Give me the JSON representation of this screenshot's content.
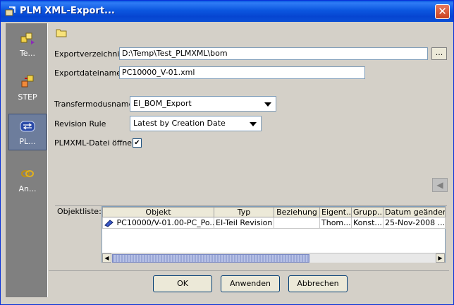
{
  "window": {
    "title": "PLM XML-Export...",
    "close_label": "✕"
  },
  "sidebar": {
    "items": [
      {
        "label": "Te...",
        "icon": "parts-icon"
      },
      {
        "label": "STEP",
        "icon": "step-icon"
      },
      {
        "label": "PL...",
        "icon": "plmxml-icon",
        "selected": true
      },
      {
        "label": "An...",
        "icon": "link-icon"
      }
    ]
  },
  "form": {
    "export_dir_label": "Exportverzeichnis:",
    "export_dir_value": "D:\\Temp\\Test_PLMXML\\bom",
    "browse_label": "...",
    "export_file_label": "Exportdateiname:",
    "export_file_value": "PC10000_V-01.xml",
    "transfer_mode_label": "Transfermodusname:",
    "transfer_mode_value": "EI_BOM_Export",
    "revision_rule_label": "Revision Rule",
    "revision_rule_value": "Latest by Creation Date",
    "open_file_label": "PLMXML-Datei öffnen",
    "open_file_checked": "✔"
  },
  "objects": {
    "label": "Objektliste:",
    "columns": [
      "Objekt",
      "Typ",
      "Beziehung",
      "Eigent...",
      "Grupp...",
      "Datum geändert"
    ],
    "rows": [
      [
        "PC10000/V-01.00-PC_Po...",
        "EI-Teil Revision",
        "",
        "Thom...",
        "Konst...",
        "25-Nov-2008 ..."
      ]
    ]
  },
  "buttons": {
    "ok": "OK",
    "apply": "Anwenden",
    "cancel": "Abbrechen"
  }
}
